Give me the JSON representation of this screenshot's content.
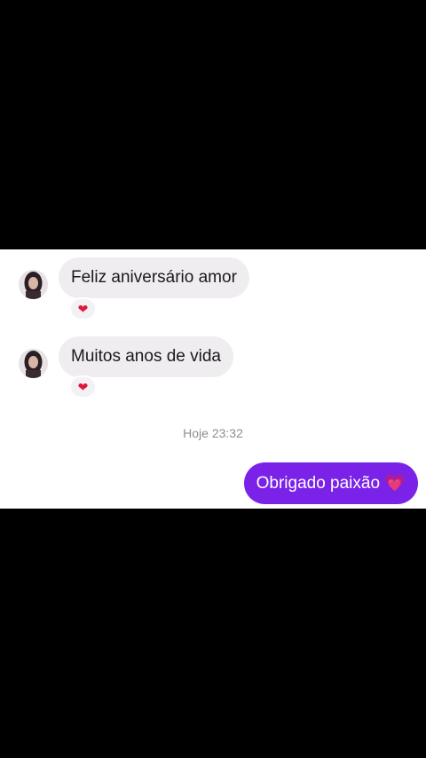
{
  "messages": [
    {
      "from": "contact",
      "text": "Feliz aniversário amor",
      "reaction": "❤"
    },
    {
      "from": "contact",
      "text": "Muitos anos de vida",
      "reaction": "❤"
    }
  ],
  "timestamp": "Hoje 23:32",
  "reply": {
    "text": "Obrigado paixão",
    "emoji": "💗"
  },
  "colors": {
    "outgoing_bubble": "#7a22e8",
    "incoming_bubble": "#efedf0",
    "reaction_heart": "#e0173b"
  }
}
